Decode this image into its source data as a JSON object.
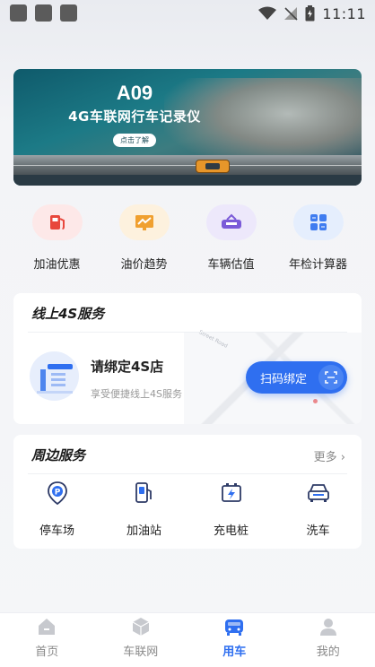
{
  "status_bar": {
    "time": "11:11"
  },
  "banner": {
    "title": "A09",
    "subtitle": "4G车联网行车记录仪",
    "button": "点击了解"
  },
  "quick_actions": [
    {
      "label": "加油优惠",
      "icon": "fuel-pump-icon",
      "color": "#e8473c",
      "bg": "#fde8e8"
    },
    {
      "label": "油价趋势",
      "icon": "trend-chart-icon",
      "color": "#f0a030",
      "bg": "#fdf1de"
    },
    {
      "label": "车辆估值",
      "icon": "car-value-icon",
      "color": "#7b5bd8",
      "bg": "#ede8fb"
    },
    {
      "label": "年检计算器",
      "icon": "calculator-icon",
      "color": "#3f7cf0",
      "bg": "#e5eefd"
    }
  ],
  "service_4s": {
    "title": "线上4S服务",
    "name": "请绑定4S店",
    "desc": "享受便捷线上4S服务",
    "scan_button": "扫码绑定",
    "map_label": "Street Road"
  },
  "nearby": {
    "title": "周边服务",
    "more": "更多",
    "items": [
      {
        "label": "停车场",
        "icon": "parking-icon"
      },
      {
        "label": "加油站",
        "icon": "gas-station-icon"
      },
      {
        "label": "充电桩",
        "icon": "charging-pile-icon"
      },
      {
        "label": "洗车",
        "icon": "car-wash-icon"
      }
    ]
  },
  "tabs": [
    {
      "label": "首页",
      "icon": "home-icon",
      "active": false
    },
    {
      "label": "车联网",
      "icon": "cube-icon",
      "active": false
    },
    {
      "label": "用车",
      "icon": "car-icon",
      "active": true
    },
    {
      "label": "我的",
      "icon": "user-icon",
      "active": false
    }
  ],
  "colors": {
    "accent": "#2f6ff0"
  }
}
